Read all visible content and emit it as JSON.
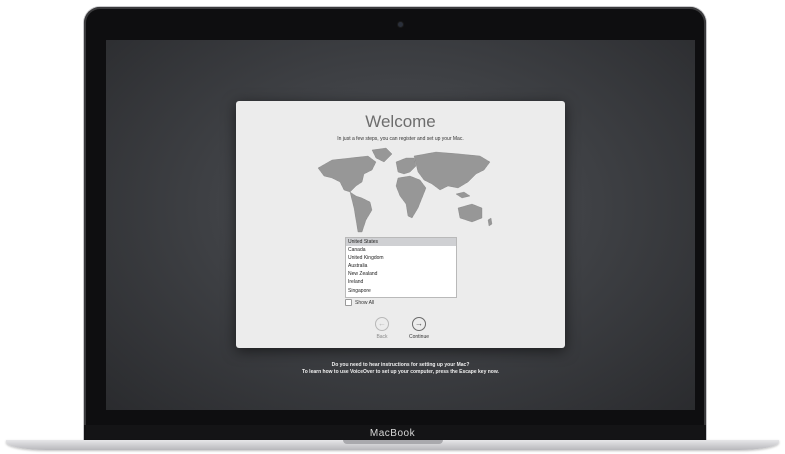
{
  "device": {
    "brand_label": "MacBook"
  },
  "dialog": {
    "title": "Welcome",
    "subtitle": "In just a few steps, you can register and set up your Mac.",
    "country_list": [
      {
        "label": "United States",
        "selected": true
      },
      {
        "label": "Canada",
        "selected": false
      },
      {
        "label": "United Kingdom",
        "selected": false
      },
      {
        "label": "Australia",
        "selected": false
      },
      {
        "label": "New Zealand",
        "selected": false
      },
      {
        "label": "Ireland",
        "selected": false
      },
      {
        "label": "Singapore",
        "selected": false
      }
    ],
    "show_all_label": "Show All",
    "back_label": "Back",
    "continue_label": "Continue"
  },
  "voiceover": {
    "line1": "Do you need to hear instructions for setting up your Mac?",
    "line2": "To learn how to use VoiceOver to set up your computer, press the Escape key now."
  },
  "colors": {
    "screen_bg": "#3f4145",
    "dialog_bg": "#ececec",
    "selection": "#cfd0d3"
  },
  "icons": {
    "back": "arrow-left-circle-icon",
    "continue": "arrow-right-circle-icon",
    "map": "world-map"
  }
}
